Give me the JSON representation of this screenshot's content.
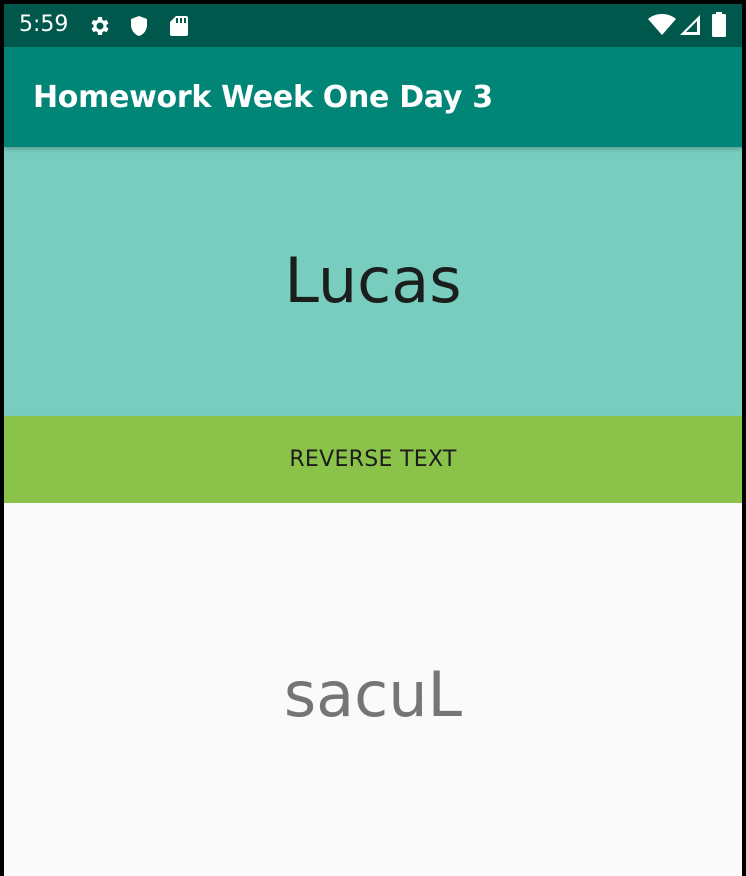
{
  "status_bar": {
    "time": "5:59",
    "left_icons": [
      "settings-icon",
      "shield-icon",
      "sd-card-icon"
    ],
    "right_icons": [
      "wifi-icon",
      "signal-icon",
      "battery-icon"
    ]
  },
  "app_bar": {
    "title": "Homework Week One Day 3"
  },
  "input": {
    "value": "Lucas"
  },
  "button": {
    "label": "REVERSE TEXT"
  },
  "output": {
    "value": "sacuL"
  },
  "colors": {
    "status_bar": "#00574b",
    "app_bar": "#008577",
    "input_panel": "#78cdbf",
    "button": "#8bc34a",
    "background": "#fafafa",
    "output_text": "#757575"
  }
}
